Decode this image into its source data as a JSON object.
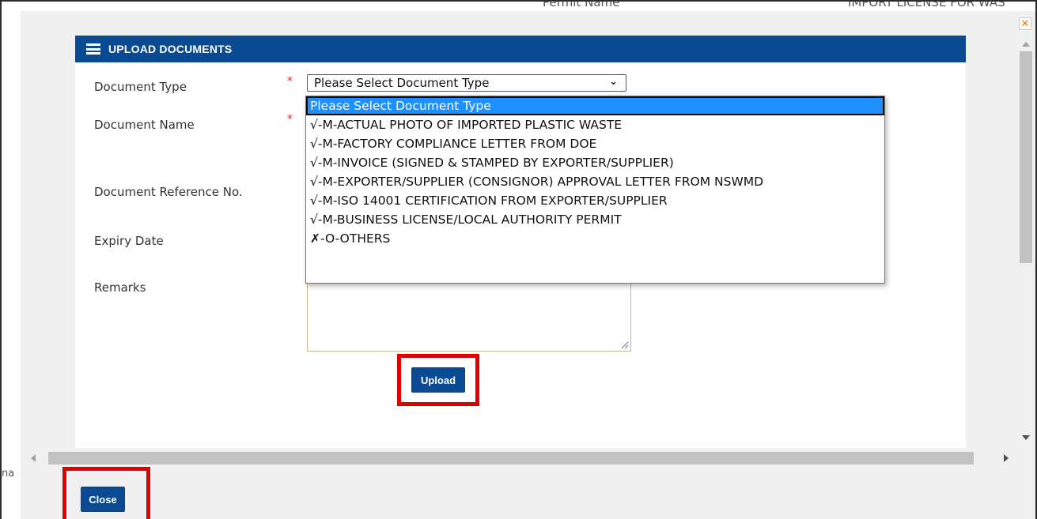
{
  "background": {
    "permit_name_label": "Permit Name",
    "permit_name_value": "IMPORT LICENSE FOR WAS"
  },
  "dialog": {
    "close_icon": "close-x-icon",
    "header_icon": "menu-icon",
    "header_title": "UPLOAD DOCUMENTS",
    "side_text": "na"
  },
  "form": {
    "document_type_label": "Document Type",
    "document_name_label": "Document Name",
    "document_reference_label": "Document Reference No.",
    "expiry_date_label": "Expiry Date",
    "remarks_label": "Remarks",
    "required_marker": "*",
    "document_type_selected": "Please Select Document Type"
  },
  "document_type_options": [
    "Please Select Document Type",
    "√-M-ACTUAL PHOTO OF IMPORTED PLASTIC WASTE",
    "√-M-FACTORY COMPLIANCE LETTER FROM DOE",
    "√-M-INVOICE (SIGNED & STAMPED BY EXPORTER/SUPPLIER)",
    "√-M-EXPORTER/SUPPLIER (CONSIGNOR) APPROVAL LETTER FROM NSWMD",
    "√-M-ISO 14001 CERTIFICATION FROM EXPORTER/SUPPLIER",
    "√-M-BUSINESS LICENSE/LOCAL AUTHORITY PERMIT",
    "✗-O-OTHERS"
  ],
  "buttons": {
    "upload": "Upload",
    "close": "Close"
  },
  "colors": {
    "header_blue": "#0a4a92",
    "highlight_red": "#e00000",
    "selected_option": "#1e90ff",
    "required_red": "#d63030"
  }
}
